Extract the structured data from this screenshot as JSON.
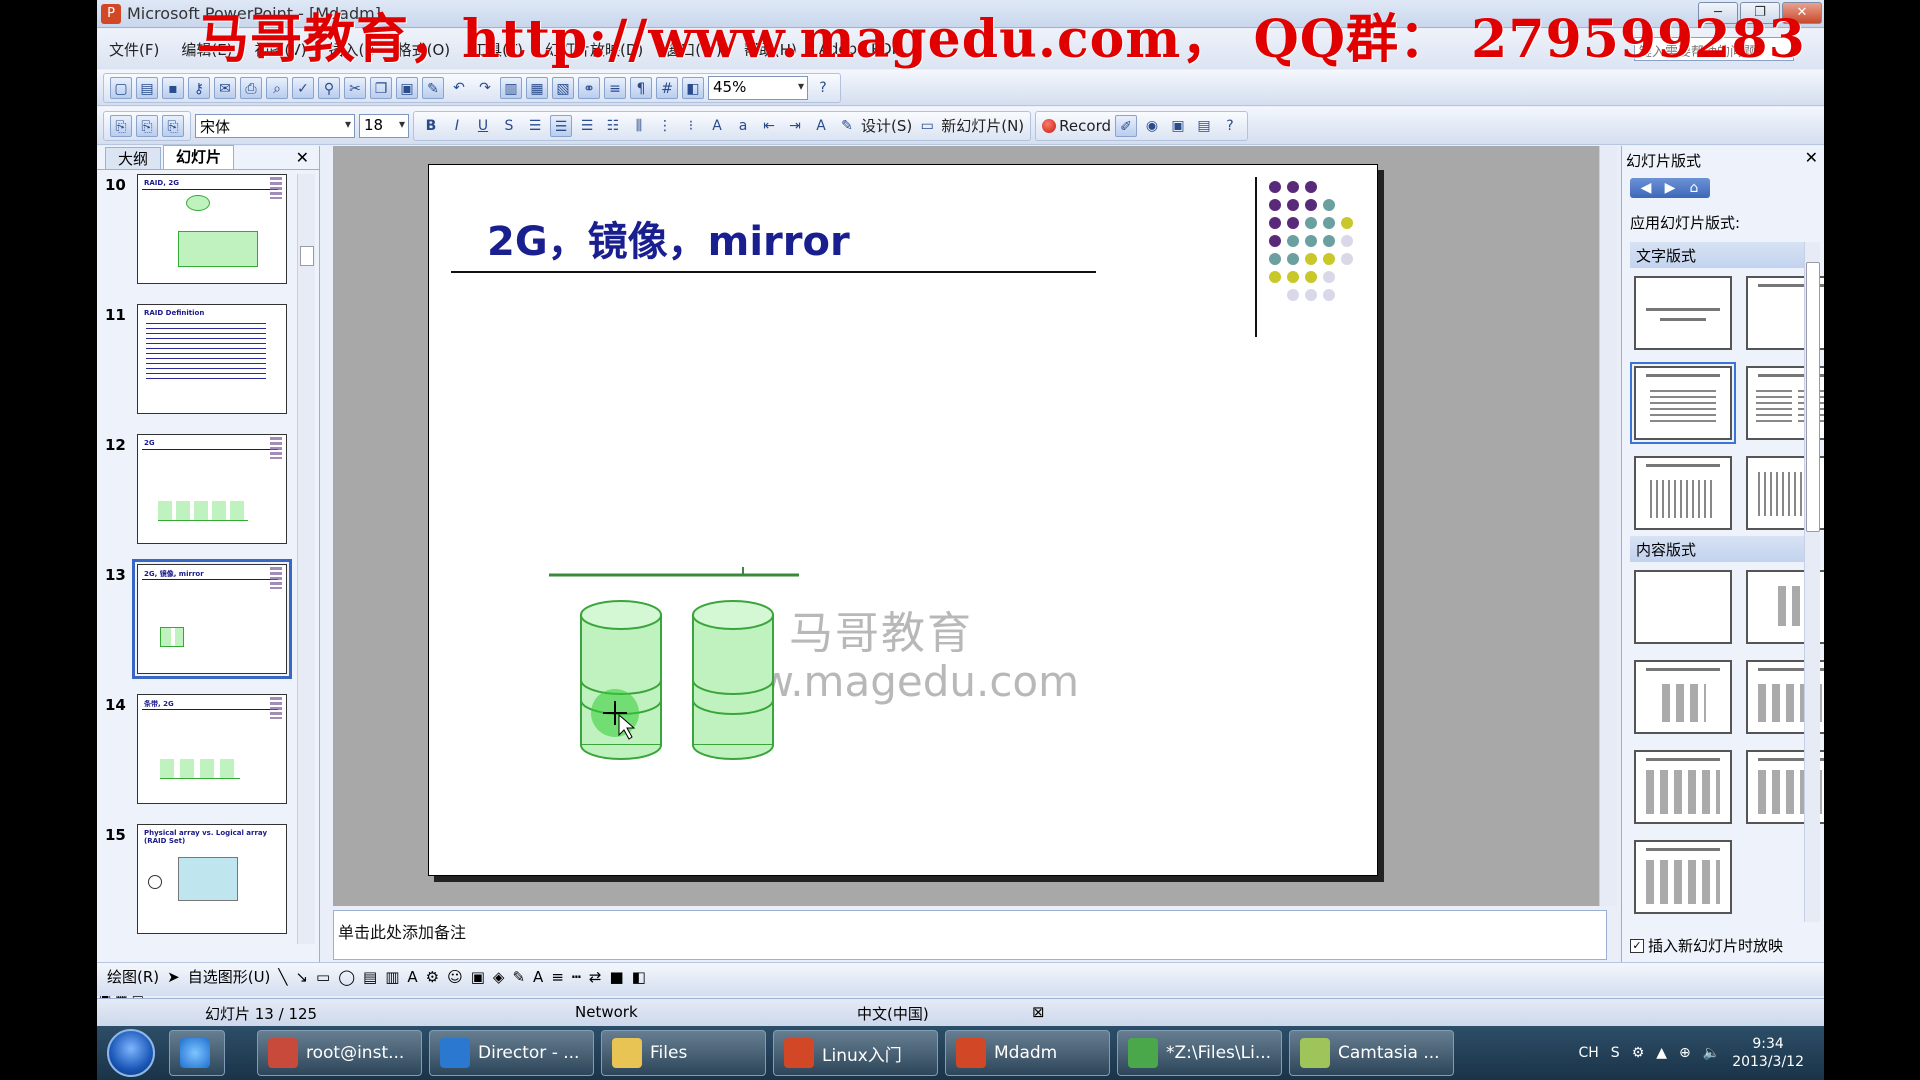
{
  "window": {
    "title": "Microsoft PowerPoint - [Mdadm]",
    "min": "─",
    "max": "❐",
    "close": "✕"
  },
  "watermark": "马哥教育，http://www.magedu.com， QQ群： 279599283",
  "menu": {
    "items": [
      "文件(F)",
      "编辑(E)",
      "视图(V)",
      "插入(I)",
      "格式(O)",
      "工具(T)",
      "幻灯片放映(D)",
      "窗口(W)",
      "帮助(H)",
      "Adobe PDF"
    ],
    "help_placeholder": "键入需要帮助的问题"
  },
  "toolbar1": {
    "zoom": "45%"
  },
  "toolbar2": {
    "font": "宋体",
    "size": "18",
    "bold": "B",
    "italic": "I",
    "underline": "U",
    "shadow": "S",
    "design": "设计(S)",
    "new_slide": "新幻灯片(N)",
    "record": "Record"
  },
  "left_panel": {
    "tab_outline": "大纲",
    "tab_slides": "幻灯片",
    "thumbnails": [
      {
        "num": "10",
        "title": "RAID, 2G"
      },
      {
        "num": "11",
        "title": "RAID Definition"
      },
      {
        "num": "12",
        "title": "2G"
      },
      {
        "num": "13",
        "title": "2G, 镜像, mirror",
        "selected": true
      },
      {
        "num": "14",
        "title": "条带, 2G"
      },
      {
        "num": "15",
        "title": "Physical array vs. Logical array (RAID Set)"
      }
    ]
  },
  "slide": {
    "title": "2G，镜像，mirror",
    "watermark_line1": "马哥教育",
    "watermark_line2": "www.magedu.com"
  },
  "notes": {
    "placeholder": "单击此处添加备注"
  },
  "task_pane": {
    "title": "幻灯片版式",
    "apply": "应用幻灯片版式:",
    "section_text": "文字版式",
    "section_content": "内容版式",
    "checkbox": "插入新幻灯片时放映"
  },
  "draw_toolbar": {
    "draw": "绘图(R)",
    "autoshapes": "自选图形(U)"
  },
  "status": {
    "slide_count": "幻灯片 13 / 125",
    "design": "Network",
    "language": "中文(中国)"
  },
  "taskbar": {
    "tasks": [
      "root@inst...",
      "Director - ...",
      "Files",
      "Linux入门",
      "Mdadm",
      "*Z:\\Files\\Li...",
      "Camtasia ..."
    ],
    "tray_lang": "CH",
    "time": "9:34",
    "date": "2013/3/12"
  },
  "colors": {
    "accent": "#1a1f8f",
    "disk_fill": "#bff2bf",
    "disk_stroke": "#3aa53a",
    "watermark_red": "#e00000"
  }
}
